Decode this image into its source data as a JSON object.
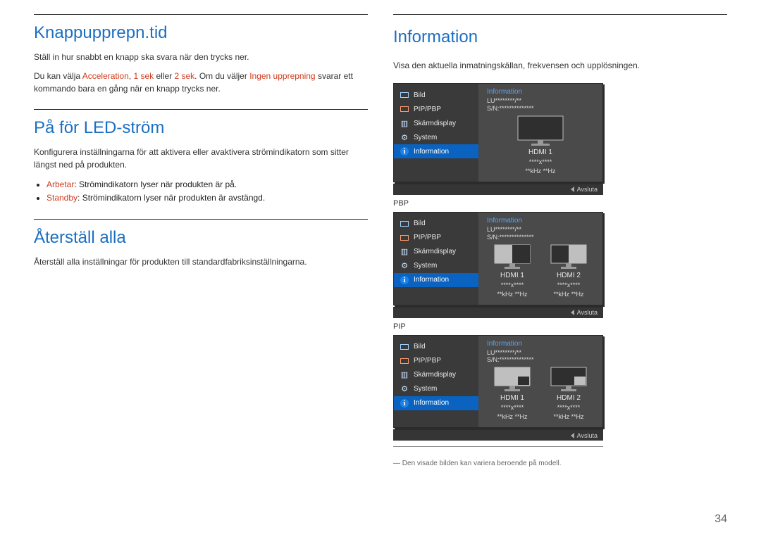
{
  "left": {
    "s1": {
      "title": "Knappupprepn.tid",
      "p1": "Ställ in hur snabbt en knapp ska svara när den trycks ner.",
      "p2a": "Du kan välja ",
      "p2b_hl": "Acceleration",
      "p2c": ", ",
      "p2d_hl": "1 sek",
      "p2e": " eller ",
      "p2f_hl": "2 sek",
      "p2g": ". Om du väljer ",
      "p2h_hl": "Ingen upprepning",
      "p2i": " svarar ett kommando bara en gång när en knapp trycks ner."
    },
    "s2": {
      "title": "På för LED-ström",
      "p1": "Konfigurera inställningarna för att aktivera eller avaktivera strömindikatorn som sitter längst ned på produkten.",
      "b1_hl": "Arbetar",
      "b1_txt": ": Strömindikatorn lyser när produkten är på.",
      "b2_hl": "Standby",
      "b2_txt": ": Strömindikatorn lyser när produkten är avstängd."
    },
    "s3": {
      "title": "Återställ alla",
      "p1": "Återställ alla inställningar för produkten till standardfabriksinställningarna."
    }
  },
  "right": {
    "title": "Information",
    "p1": "Visa den aktuella inmatningskällan, frekvensen och upplösningen.",
    "menu": {
      "m1": "Bild",
      "m2": "PIP/PBP",
      "m3": "Skärmdisplay",
      "m4": "System",
      "m5": "Information"
    },
    "info_head": "Information",
    "info_line1": "LU********/**",
    "info_line2": "S/N:**************",
    "mon": {
      "hdmi1": "HDMI 1",
      "hdmi2": "HDMI 2",
      "res": "****x****",
      "freq": "**kHz **Hz"
    },
    "footer": "Avsluta",
    "label_pbp": "PBP",
    "label_pip": "PIP",
    "footnote": "Den visade bilden kan variera beroende på modell."
  },
  "page_number": "34"
}
